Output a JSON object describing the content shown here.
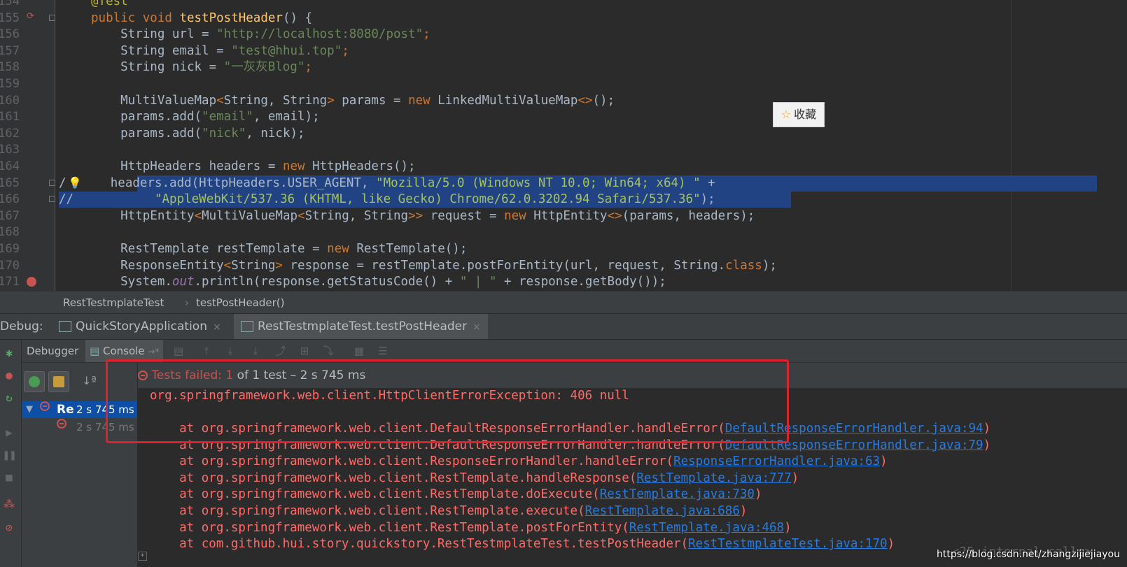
{
  "editor": {
    "lines": [
      {
        "num": "154",
        "tokens": [
          {
            "t": "@Test",
            "c": "ann"
          }
        ]
      },
      {
        "num": "155",
        "tokens": [
          {
            "t": "public void ",
            "c": "kw"
          },
          {
            "t": "testPostHeader",
            "c": "fn"
          },
          {
            "t": "() {",
            "c": "pl"
          }
        ]
      },
      {
        "num": "156",
        "tokens": [
          {
            "t": "    String url = ",
            "c": "pl"
          },
          {
            "t": "\"http://localhost:8080/post\"",
            "c": "str"
          },
          {
            "t": ";",
            "c": "kw"
          }
        ]
      },
      {
        "num": "157",
        "tokens": [
          {
            "t": "    String email = ",
            "c": "pl"
          },
          {
            "t": "\"test@hhui.top\"",
            "c": "str"
          },
          {
            "t": ";",
            "c": "kw"
          }
        ]
      },
      {
        "num": "158",
        "tokens": [
          {
            "t": "    String nick = ",
            "c": "pl"
          },
          {
            "t": "\"一灰灰Blog\"",
            "c": "str"
          },
          {
            "t": ";",
            "c": "kw"
          }
        ]
      },
      {
        "num": "159",
        "tokens": []
      },
      {
        "num": "160",
        "tokens": [
          {
            "t": "    MultiValueMap",
            "c": "pl"
          },
          {
            "t": "<",
            "c": "kw"
          },
          {
            "t": "String, String",
            "c": "pl"
          },
          {
            "t": ">",
            "c": "kw"
          },
          {
            "t": " params = ",
            "c": "pl"
          },
          {
            "t": "new ",
            "c": "kw"
          },
          {
            "t": "LinkedMultiValueMap",
            "c": "pl"
          },
          {
            "t": "<>",
            "c": "kw"
          },
          {
            "t": "();",
            "c": "pl"
          }
        ]
      },
      {
        "num": "161",
        "tokens": [
          {
            "t": "    params.add(",
            "c": "pl"
          },
          {
            "t": "\"email\"",
            "c": "str"
          },
          {
            "t": ", email);",
            "c": "pl"
          }
        ]
      },
      {
        "num": "162",
        "tokens": [
          {
            "t": "    params.add(",
            "c": "pl"
          },
          {
            "t": "\"nick\"",
            "c": "str"
          },
          {
            "t": ", nick);",
            "c": "pl"
          }
        ]
      },
      {
        "num": "163",
        "tokens": []
      },
      {
        "num": "164",
        "tokens": [
          {
            "t": "    HttpHeaders headers = ",
            "c": "pl"
          },
          {
            "t": "new ",
            "c": "kw"
          },
          {
            "t": "HttpHeaders();",
            "c": "pl"
          }
        ]
      },
      {
        "num": "165",
        "tokens": [
          {
            "t": "/      headers.add(HttpHeaders.USER_AGENT, ",
            "c": "cm-sel"
          },
          {
            "t": "\"Mozilla/5.0 (Windows NT 10.0; Win64; x64) \"",
            "c": "str-sel"
          },
          {
            "t": " +",
            "c": "cm-sel"
          }
        ]
      },
      {
        "num": "166",
        "tokens": [
          {
            "t": "//           ",
            "c": "cm-sel"
          },
          {
            "t": "\"AppleWebKit/537.36 (KHTML, like Gecko) Chrome/62.0.3202.94 Safari/537.36\"",
            "c": "str-sel"
          },
          {
            "t": ");",
            "c": "cm-sel"
          }
        ]
      },
      {
        "num": "167",
        "tokens": [
          {
            "t": "    HttpEntity",
            "c": "pl"
          },
          {
            "t": "<",
            "c": "kw"
          },
          {
            "t": "MultiValueMap",
            "c": "pl"
          },
          {
            "t": "<",
            "c": "kw"
          },
          {
            "t": "String, String",
            "c": "pl"
          },
          {
            "t": ">>",
            "c": "kw"
          },
          {
            "t": " request = ",
            "c": "pl"
          },
          {
            "t": "new ",
            "c": "kw"
          },
          {
            "t": "HttpEntity",
            "c": "pl"
          },
          {
            "t": "<>",
            "c": "kw"
          },
          {
            "t": "(params, headers);",
            "c": "pl"
          }
        ]
      },
      {
        "num": "168",
        "tokens": []
      },
      {
        "num": "169",
        "tokens": [
          {
            "t": "    RestTemplate restTemplate = ",
            "c": "pl"
          },
          {
            "t": "new ",
            "c": "kw"
          },
          {
            "t": "RestTemplate();",
            "c": "pl"
          }
        ]
      },
      {
        "num": "170",
        "tokens": [
          {
            "t": "    ResponseEntity",
            "c": "pl"
          },
          {
            "t": "<",
            "c": "kw"
          },
          {
            "t": "String",
            "c": "pl"
          },
          {
            "t": ">",
            "c": "kw"
          },
          {
            "t": " response = restTemplate.postForEntity(url, request, String.",
            "c": "pl"
          },
          {
            "t": "class",
            "c": "kw"
          },
          {
            "t": ");",
            "c": "pl"
          }
        ]
      },
      {
        "num": "171",
        "tokens": [
          {
            "t": "    System.",
            "c": "pl"
          },
          {
            "t": "out",
            "c": "fld"
          },
          {
            "t": ".println(response.getStatusCode() + ",
            "c": "pl"
          },
          {
            "t": "\" | \"",
            "c": "str"
          },
          {
            "t": " + response.getBody());",
            "c": "pl"
          }
        ]
      }
    ],
    "collect_button": {
      "icon": "star-icon",
      "label": "收藏"
    }
  },
  "breadcrumb": {
    "items": [
      "RestTestmplateTest",
      "testPostHeader()"
    ],
    "separator": "›"
  },
  "debug": {
    "label": "Debug:",
    "tabs": [
      {
        "label": "QuickStoryApplication",
        "close": "×"
      },
      {
        "label": "RestTestmplateTest.testPostHeader",
        "close": "×"
      }
    ],
    "subtabs": {
      "debugger": "Debugger",
      "console": "Console",
      "console_suffix": "→*"
    }
  },
  "tree": {
    "sort_icon": "↓ª",
    "row1": {
      "name": "Re",
      "time": "2 s 745 ms"
    },
    "row2": {
      "time": "2 s 745 ms"
    }
  },
  "console": {
    "status_prefix": "»",
    "status_fail": "Tests failed: 1",
    "status_rest": " of 1 test – 2 s 745 ms",
    "exception": "org.springframework.web.client.HttpClientErrorException: 406 null",
    "stack": [
      {
        "at": "    at org.springframework.web.client.DefaultResponseErrorHandler.handleError(",
        "link": "DefaultResponseErrorHandler.java:94",
        "end": ")"
      },
      {
        "at": "    at org.springframework.web.client.DefaultResponseErrorHandler.handleError(",
        "link": "DefaultResponseErrorHandler.java:79",
        "end": ")"
      },
      {
        "at": "    at org.springframework.web.client.ResponseErrorHandler.handleError(",
        "link": "ResponseErrorHandler.java:63",
        "end": ")"
      },
      {
        "at": "    at org.springframework.web.client.RestTemplate.handleResponse(",
        "link": "RestTemplate.java:777",
        "end": ")"
      },
      {
        "at": "    at org.springframework.web.client.RestTemplate.doExecute(",
        "link": "RestTemplate.java:730",
        "end": ")"
      },
      {
        "at": "    at org.springframework.web.client.RestTemplate.execute(",
        "link": "RestTemplate.java:686",
        "end": ")"
      },
      {
        "at": "    at org.springframework.web.client.RestTemplate.postForEntity(",
        "link": "RestTemplate.java:468",
        "end": ")"
      },
      {
        "at": "    at com.github.hui.story.quickstory.RestTestmplateTest.testPostHeader(",
        "link": "RestTestmplateTest.java:170",
        "end": ")"
      }
    ],
    "internal_calls": "<25 internal calls>"
  },
  "watermark": "https://blog.csdn.net/zhangzijiejiayou",
  "colors": {
    "fail": "#c75450",
    "link": "#287bde",
    "selection": "#214283",
    "highlight_box": "#e0202a"
  }
}
